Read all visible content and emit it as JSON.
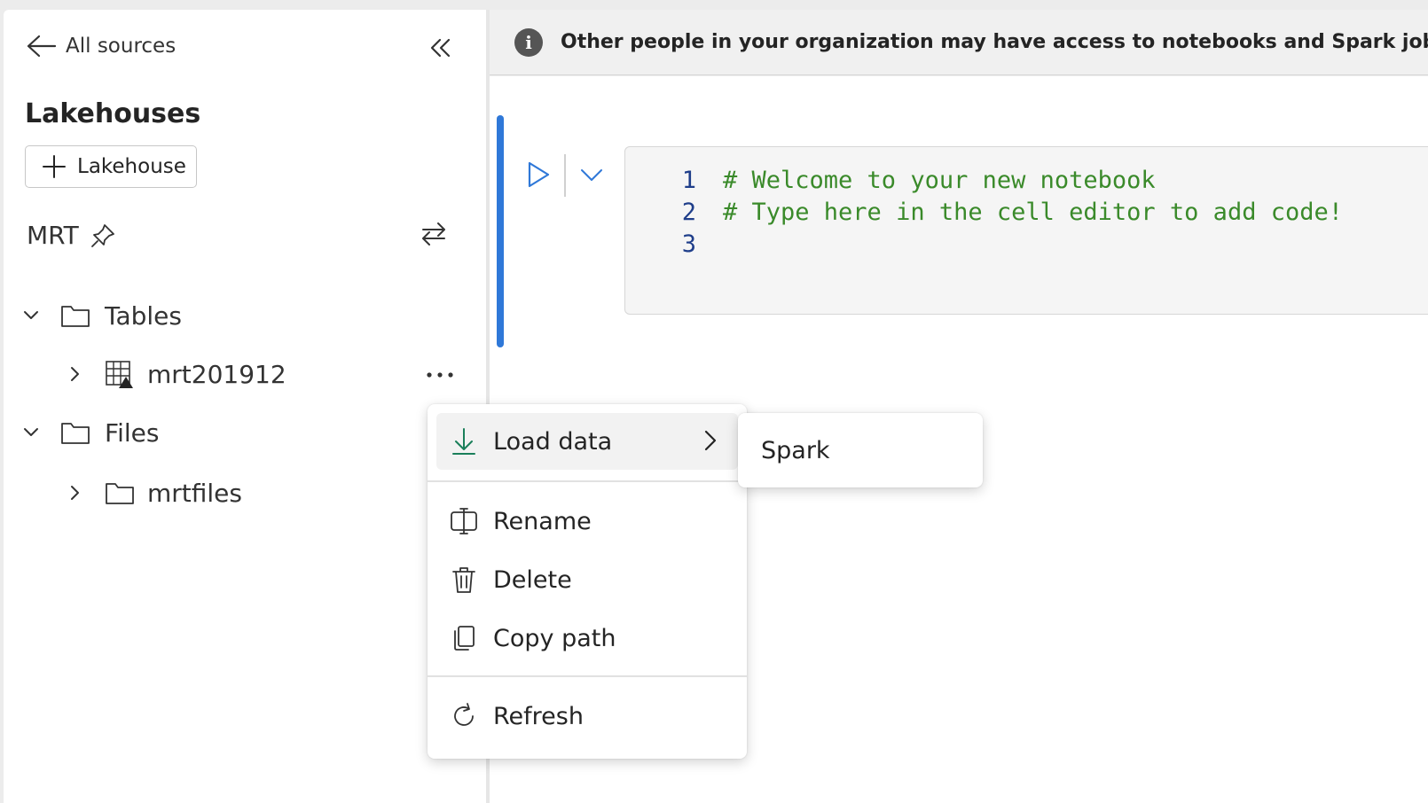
{
  "panel": {
    "back_label": "All sources",
    "section_title": "Lakehouses",
    "add_button_label": "Lakehouse",
    "lakehouse_name": "MRT",
    "tree": {
      "tables_label": "Tables",
      "table_item": "mrt201912",
      "files_label": "Files",
      "file_item": "mrtfiles"
    }
  },
  "banner": {
    "message": "Other people in your organization may have access to notebooks and Spark job definiti",
    "info_glyph": "i"
  },
  "editor": {
    "lines": [
      {
        "num": "1",
        "text": "# Welcome to your new notebook"
      },
      {
        "num": "2",
        "text": "# Type here in the cell editor to add code!"
      },
      {
        "num": "3",
        "text": ""
      }
    ]
  },
  "context_menu": {
    "items": [
      {
        "label": "Load data",
        "icon": "download-icon"
      },
      {
        "label": "Rename",
        "icon": "rename-icon"
      },
      {
        "label": "Delete",
        "icon": "trash-icon"
      },
      {
        "label": "Copy path",
        "icon": "copy-icon"
      },
      {
        "label": "Refresh",
        "icon": "refresh-icon"
      }
    ],
    "submenu_items": [
      "Spark"
    ]
  },
  "colors": {
    "accent": "#2f78d8",
    "code_comment": "#3a8a2a",
    "line_number": "#1f3e8a",
    "load_icon": "#1a7f5a"
  }
}
